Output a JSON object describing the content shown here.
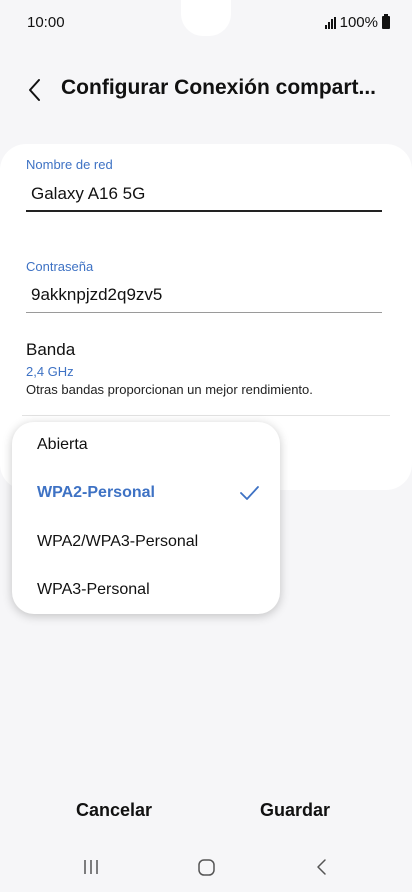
{
  "status_bar": {
    "time": "10:00",
    "battery": "100%",
    "icons": [
      "signal-icon",
      "battery-icon"
    ]
  },
  "header": {
    "title": "Configurar Conexión compart...",
    "back_icon": "chevron-left-icon"
  },
  "form": {
    "network_name": {
      "label": "Nombre de red",
      "value": "Galaxy A16 5G"
    },
    "password": {
      "label": "Contraseña",
      "value": "9akknpjzd2q9zv5"
    },
    "band": {
      "title": "Banda",
      "value": "2,4 GHz",
      "description": "Otras bandas proporcionan un mejor rendimiento."
    }
  },
  "security_dropdown": {
    "options": [
      {
        "label": "Abierta",
        "selected": false
      },
      {
        "label": "WPA2-Personal",
        "selected": true
      },
      {
        "label": "WPA2/WPA3-Personal",
        "selected": false
      },
      {
        "label": "WPA3-Personal",
        "selected": false
      }
    ],
    "check_icon": "checkmark-icon"
  },
  "actions": {
    "cancel_label": "Cancelar",
    "save_label": "Guardar"
  },
  "navigation": {
    "icons": [
      "recent-apps-icon",
      "home-icon",
      "back-icon"
    ]
  },
  "colors": {
    "accent": "#3e72c4",
    "background": "#f6f6f8",
    "card": "#ffffff"
  }
}
